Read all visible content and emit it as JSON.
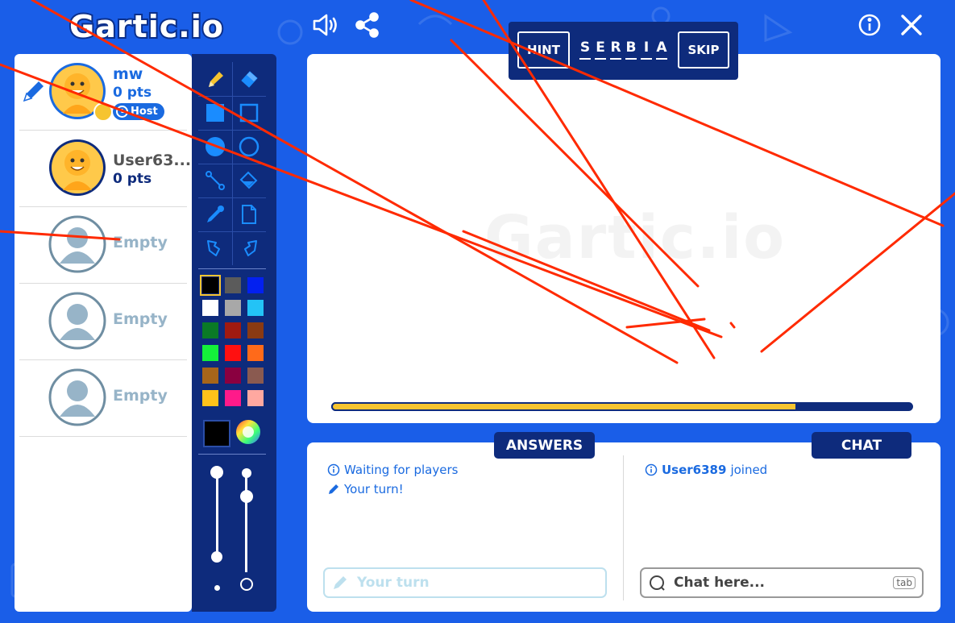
{
  "app": {
    "logo_text": "Gartic.io",
    "watermark_text": "Gartic.io"
  },
  "toolbar_top": {
    "sound_icon": "speaker-icon",
    "share_icon": "share-icon",
    "info_icon": "info-icon",
    "close_icon": "close-icon"
  },
  "word_bar": {
    "hint_label": "HINT",
    "skip_label": "SKIP",
    "word_letters": [
      "S",
      "E",
      "R",
      "B",
      "I",
      "A"
    ]
  },
  "players": [
    {
      "name": "mw",
      "points": "0 pts",
      "badge": "Host",
      "drawing": true
    },
    {
      "name": "User63...",
      "points": "0 pts"
    },
    {
      "name": "Empty"
    },
    {
      "name": "Empty"
    },
    {
      "name": "Empty"
    }
  ],
  "palette": {
    "colors": [
      "#000000",
      "#5b5b5b",
      "#0320f0",
      "#ffffff",
      "#a8a8a8",
      "#23c3f6",
      "#0a7a26",
      "#a01a10",
      "#8a3a12",
      "#14f03a",
      "#ff1010",
      "#ff6a1a",
      "#a7651a",
      "#8a0040",
      "#8a5a50",
      "#ffc21a",
      "#ff1a8a",
      "#ffa8a0"
    ],
    "selected_index": 0,
    "current_color": "#000000"
  },
  "progress": {
    "fraction": 0.8
  },
  "answers": {
    "tab_label": "ANSWERS",
    "messages": [
      "Waiting for players",
      "Your turn!"
    ],
    "input_placeholder": "Your turn"
  },
  "chat": {
    "tab_label": "CHAT",
    "join_user": "User6389",
    "join_text": "joined",
    "input_placeholder": "Chat here...",
    "tab_key_label": "tab"
  },
  "colors": {
    "brand_blue": "#1a5ee8",
    "navy": "#0e2b7c",
    "accent_yellow": "#f6c430",
    "stroke_red": "#ff2a00"
  }
}
